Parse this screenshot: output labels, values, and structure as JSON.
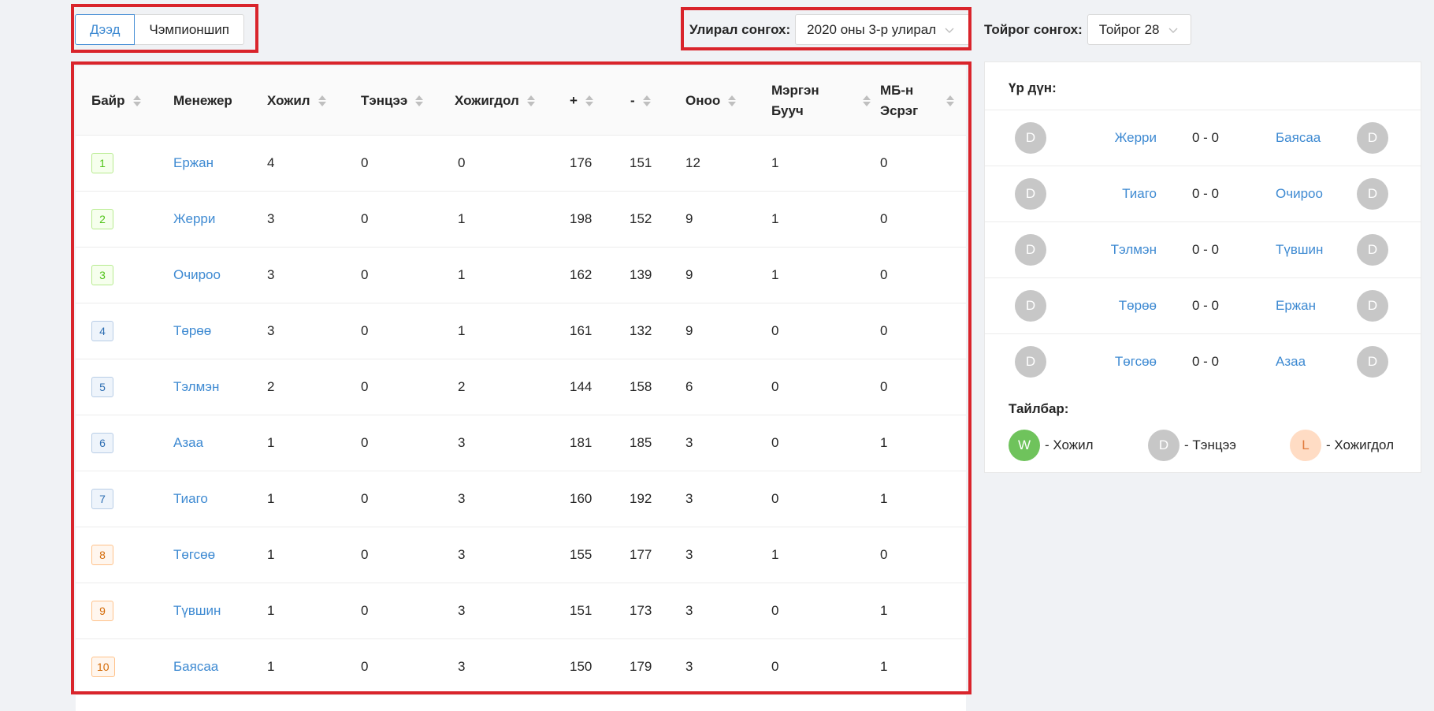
{
  "tabs": [
    {
      "label": "Дээд",
      "active": true
    },
    {
      "label": "Чэмпионшип",
      "active": false
    }
  ],
  "season": {
    "label": "Улирал сонгох:",
    "value": "2020 оны 3-р улирал"
  },
  "round": {
    "label": "Тойрог сонгох:",
    "value": "Тойрог 28"
  },
  "table": {
    "headers": [
      "Байр",
      "Менежер",
      "Хожил",
      "Тэнцээ",
      "Хожигдол",
      "+",
      "-",
      "Оноо",
      "Мэргэн Бууч",
      "МБ-н Эсрэг"
    ],
    "header_lines": {
      "mergen": [
        "Мэргэн",
        "Бууч"
      ],
      "mb": [
        "МБ-н",
        "Эсрэг"
      ]
    },
    "rows": [
      {
        "rank": "1",
        "rank_color": "green",
        "manager": "Ержан",
        "won": "4",
        "draw": "0",
        "lost": "0",
        "plus": "176",
        "minus": "151",
        "points": "12",
        "mergen": "1",
        "mb": "0"
      },
      {
        "rank": "2",
        "rank_color": "green",
        "manager": "Жерри",
        "won": "3",
        "draw": "0",
        "lost": "1",
        "plus": "198",
        "minus": "152",
        "points": "9",
        "mergen": "1",
        "mb": "0"
      },
      {
        "rank": "3",
        "rank_color": "green",
        "manager": "Очироо",
        "won": "3",
        "draw": "0",
        "lost": "1",
        "plus": "162",
        "minus": "139",
        "points": "9",
        "mergen": "1",
        "mb": "0"
      },
      {
        "rank": "4",
        "rank_color": "blue",
        "manager": "Төрөө",
        "won": "3",
        "draw": "0",
        "lost": "1",
        "plus": "161",
        "minus": "132",
        "points": "9",
        "mergen": "0",
        "mb": "0"
      },
      {
        "rank": "5",
        "rank_color": "blue",
        "manager": "Тэлмэн",
        "won": "2",
        "draw": "0",
        "lost": "2",
        "plus": "144",
        "minus": "158",
        "points": "6",
        "mergen": "0",
        "mb": "0"
      },
      {
        "rank": "6",
        "rank_color": "blue",
        "manager": "Азаа",
        "won": "1",
        "draw": "0",
        "lost": "3",
        "plus": "181",
        "minus": "185",
        "points": "3",
        "mergen": "0",
        "mb": "1"
      },
      {
        "rank": "7",
        "rank_color": "blue",
        "manager": "Тиаго",
        "won": "1",
        "draw": "0",
        "lost": "3",
        "plus": "160",
        "minus": "192",
        "points": "3",
        "mergen": "0",
        "mb": "1"
      },
      {
        "rank": "8",
        "rank_color": "orange",
        "manager": "Төгсөө",
        "won": "1",
        "draw": "0",
        "lost": "3",
        "plus": "155",
        "minus": "177",
        "points": "3",
        "mergen": "1",
        "mb": "0"
      },
      {
        "rank": "9",
        "rank_color": "orange",
        "manager": "Түвшин",
        "won": "1",
        "draw": "0",
        "lost": "3",
        "plus": "151",
        "minus": "173",
        "points": "3",
        "mergen": "0",
        "mb": "1"
      },
      {
        "rank": "10",
        "rank_color": "orange",
        "manager": "Баясаа",
        "won": "1",
        "draw": "0",
        "lost": "3",
        "plus": "150",
        "minus": "179",
        "points": "3",
        "mergen": "0",
        "mb": "1"
      }
    ]
  },
  "results": {
    "title": "Үр дүн:",
    "matches": [
      {
        "home": "Жерри",
        "score": "0 - 0",
        "away": "Баясаа",
        "home_avatar": "D",
        "away_avatar": "D"
      },
      {
        "home": "Тиаго",
        "score": "0 - 0",
        "away": "Очироо",
        "home_avatar": "D",
        "away_avatar": "D"
      },
      {
        "home": "Тэлмэн",
        "score": "0 - 0",
        "away": "Түвшин",
        "home_avatar": "D",
        "away_avatar": "D"
      },
      {
        "home": "Төрөө",
        "score": "0 - 0",
        "away": "Ержан",
        "home_avatar": "D",
        "away_avatar": "D"
      },
      {
        "home": "Төгсөө",
        "score": "0 - 0",
        "away": "Азаа",
        "home_avatar": "D",
        "away_avatar": "D"
      }
    ],
    "legend_title": "Тайлбар:",
    "legend": [
      {
        "letter": "W",
        "label": "- Хожил"
      },
      {
        "letter": "D",
        "label": "- Тэнцээ"
      },
      {
        "letter": "L",
        "label": "- Хожигдол"
      }
    ]
  },
  "colors": {
    "accent": "#3e8ad2",
    "highlight": "#d9242b",
    "win": "#6fc35c",
    "draw": "#c7c7c7",
    "loss": "#ffdcc4"
  }
}
